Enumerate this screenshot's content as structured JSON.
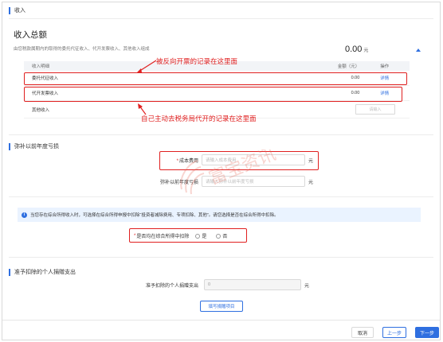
{
  "income_section": {
    "header": "收入",
    "title": "收入总额",
    "subtitle": "由您税款属期内的取得的委托代征收入、代开发票收入、其他收入组成",
    "total_amount": "0.00",
    "total_unit": "元",
    "table": {
      "columns": [
        "收入明细",
        "金额（元）",
        "操作"
      ],
      "rows": [
        {
          "name": "委托代征收入",
          "amount": "0.00",
          "action": "详情"
        },
        {
          "name": "代开发票收入",
          "amount": "0.00",
          "action": "详情"
        },
        {
          "name": "其他收入",
          "input_placeholder": "请输入"
        }
      ]
    }
  },
  "annotations": {
    "top": "被反向开票的记录在这里面",
    "bottom": "自己主动去税务局代开的记录在这里面"
  },
  "loss_section": {
    "header": "弥补以前年度亏损",
    "cost": {
      "label": "成本费用",
      "placeholder": "请输入成本费用",
      "unit": "元"
    },
    "prior_loss": {
      "label": "弥补以前年度亏损",
      "placeholder": "请输入弥补以前年度亏损",
      "unit": "元"
    }
  },
  "notice": {
    "text": "当您存在综合所得收入时，可选择在综合所得申报中扣除“投资者减除费用、专项扣除、其他”。请您选择是否在综合所得中扣除。",
    "question": "是否均在综合所得中扣除",
    "option_yes": "是",
    "option_no": "否"
  },
  "donation_section": {
    "header": "准予扣除的个人捐赠支出",
    "field_label": "准予扣除的个人捐赠支出",
    "field_value": "0",
    "unit": "元",
    "fill_button": "填写捐赠项目"
  },
  "watermark": {
    "text": "富宝资讯"
  },
  "footer": {
    "cancel": "取消",
    "prev": "上一步",
    "next": "下一步"
  },
  "colors": {
    "accent": "#2f6fe0",
    "annotation": "#e02020"
  }
}
